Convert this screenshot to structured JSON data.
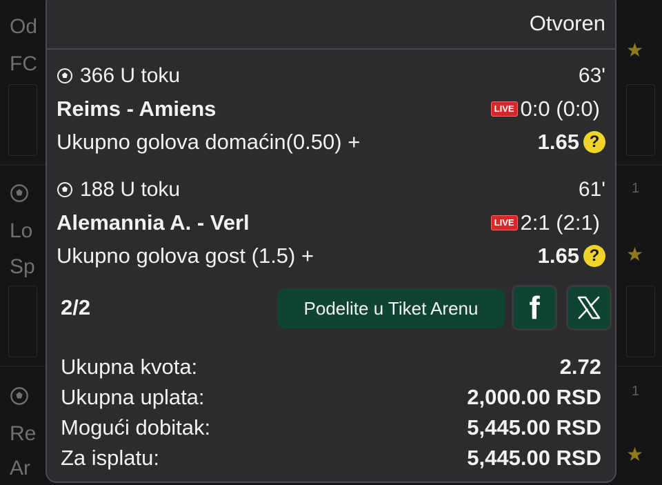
{
  "background": {
    "texts": [
      "Od",
      "FC",
      "Lo",
      "Sp",
      "Re",
      "Ar"
    ],
    "counts": [
      "1",
      "1"
    ]
  },
  "ticket": {
    "status": "Otvoren",
    "bets": [
      {
        "code": "366 U toku",
        "minute": "63'",
        "teams": "Reims - Amiens",
        "live_badge": "LIVE",
        "score": "0:0 (0:0)",
        "market": "Ukupno golova domaćin(0.50) +",
        "odd": "1.65",
        "help": "?"
      },
      {
        "code": "188 U toku",
        "minute": "61'",
        "teams": "Alemannia A. - Verl",
        "live_badge": "LIVE",
        "score": "2:1 (2:1)",
        "market": "Ukupno golova gost (1.5) +",
        "odd": "1.65",
        "help": "?"
      }
    ],
    "pager": "2/2",
    "share_label": "Podelite u Tiket Arenu",
    "facebook_icon": "f",
    "summary": [
      {
        "label": "Ukupna kvota:",
        "value": "2.72"
      },
      {
        "label": "Ukupna uplata:",
        "value": "2,000.00 RSD"
      },
      {
        "label": "Mogući dobitak:",
        "value": "5,445.00 RSD"
      },
      {
        "label": "Za isplatu:",
        "value": "5,445.00 RSD"
      }
    ]
  },
  "colors": {
    "accent_green": "#0f4530",
    "live_red": "#d8262b",
    "help_yellow": "#f0d42a"
  }
}
